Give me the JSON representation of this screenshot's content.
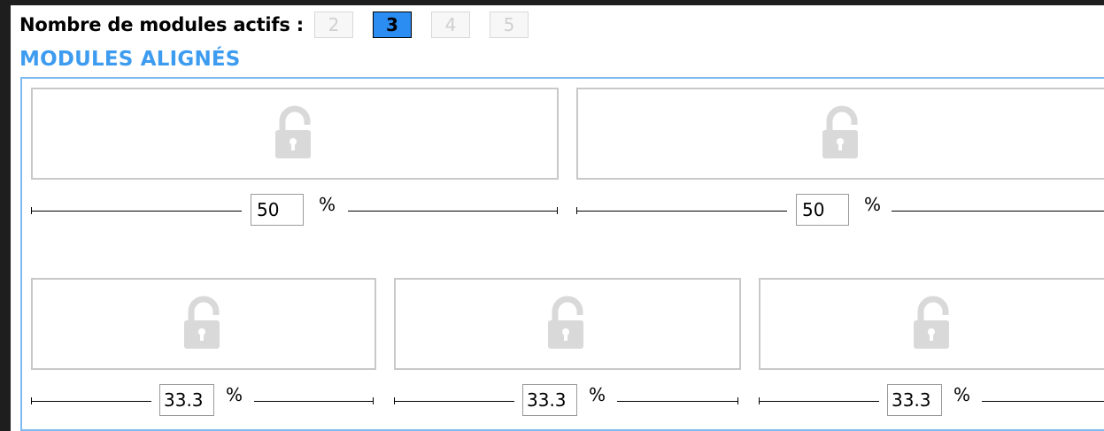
{
  "header": {
    "label": "Nombre de modules actifs :",
    "counts": [
      "2",
      "3",
      "4",
      "5"
    ],
    "selected": "3"
  },
  "section": {
    "title": "MODULES ALIGNÉS"
  },
  "rows": [
    {
      "modules": [
        {
          "icon": "unlocked-padlock-icon",
          "width_value": "50",
          "unit": "%"
        },
        {
          "icon": "unlocked-padlock-icon",
          "width_value": "50",
          "unit": "%"
        }
      ]
    },
    {
      "modules": [
        {
          "icon": "unlocked-padlock-icon",
          "width_value": "33.3",
          "unit": "%"
        },
        {
          "icon": "unlocked-padlock-icon",
          "width_value": "33.3",
          "unit": "%"
        },
        {
          "icon": "unlocked-padlock-icon",
          "width_value": "33.3",
          "unit": "%"
        }
      ]
    }
  ],
  "colors": {
    "accent": "#2b8df2",
    "section_title": "#3d9cf0",
    "box_border": "#7fbbf0",
    "module_border": "#c8c8c8",
    "lock_icon": "#d9d9d9"
  }
}
